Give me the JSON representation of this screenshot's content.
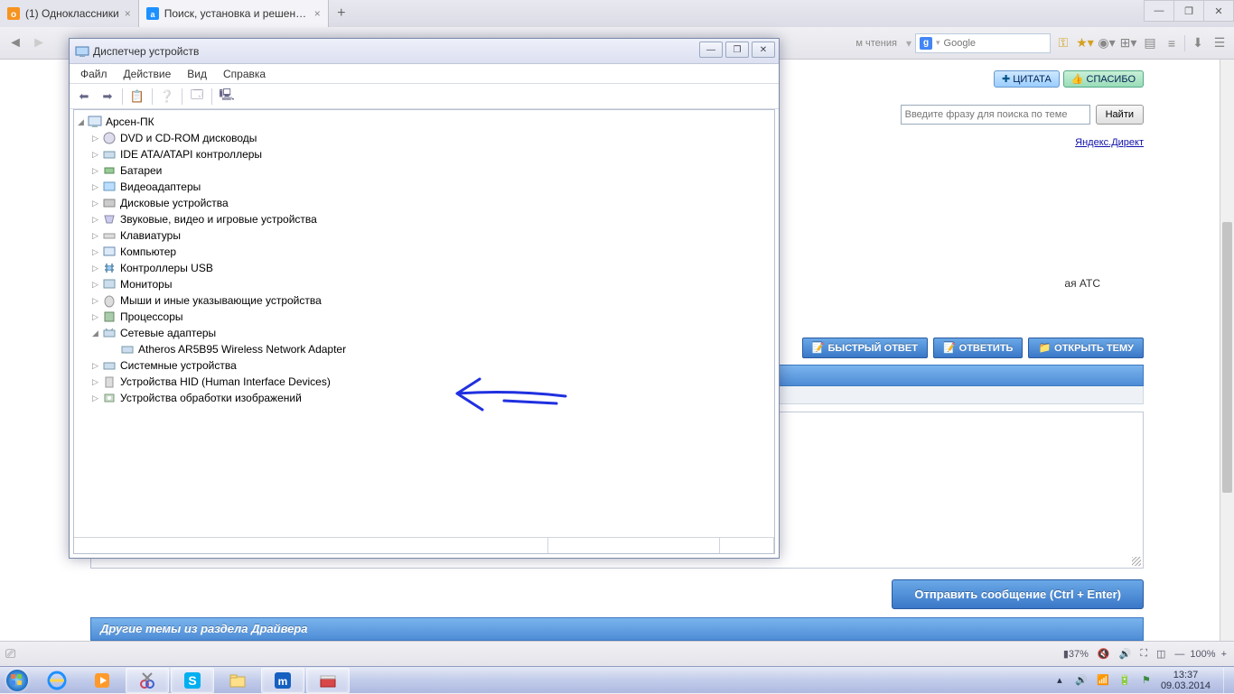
{
  "browser": {
    "tabs": [
      {
        "title": "(1) Одноклассники",
        "favicon": "#f7931e"
      },
      {
        "title": "Поиск, установка и решение п...",
        "favicon": "#1e90ff"
      }
    ],
    "window_buttons": {
      "min": "—",
      "max": "❐",
      "close": "✕"
    },
    "reader_mode": "м чтения",
    "search": {
      "engine_letter": "g",
      "placeholder": "Google"
    },
    "zoom": {
      "minus": "—",
      "value": "100%",
      "plus": "+"
    }
  },
  "page": {
    "quote_btn": "ЦИТАТА",
    "thanks_btn": "СПАСИБО",
    "search_thread_placeholder": "Введите фразу для поиска по теме",
    "find_btn": "Найти",
    "yandex_direct": "Яндекс.Директ",
    "ats_text": "ая АТС",
    "fast_reply": "БЫСТРЫЙ ОТВЕТ",
    "reply": "ОТВЕТИТЬ",
    "open_topic": "ОТКРЫТЬ ТЕМУ",
    "send_btn": "Отправить сообщение (Ctrl + Enter)",
    "section_header": "Другие темы из раздела Драйвера"
  },
  "devmgr": {
    "title": "Диспетчер устройств",
    "menu": {
      "file": "Файл",
      "action": "Действие",
      "view": "Вид",
      "help": "Справка"
    },
    "root": "Арсен-ПК",
    "nodes": [
      "DVD и CD-ROM дисководы",
      "IDE ATA/ATAPI контроллеры",
      "Батареи",
      "Видеоадаптеры",
      "Дисковые устройства",
      "Звуковые, видео и игровые устройства",
      "Клавиатуры",
      "Компьютер",
      "Контроллеры USB",
      "Мониторы",
      "Мыши и иные указывающие устройства",
      "Процессоры",
      "Сетевые адаптеры",
      "Системные устройства",
      "Устройства HID (Human Interface Devices)",
      "Устройства обработки изображений"
    ],
    "network_child": "Atheros AR5B95 Wireless Network Adapter"
  },
  "status": {
    "battery": "37%"
  },
  "tray": {
    "time": "13:37",
    "date": "09.03.2014"
  }
}
